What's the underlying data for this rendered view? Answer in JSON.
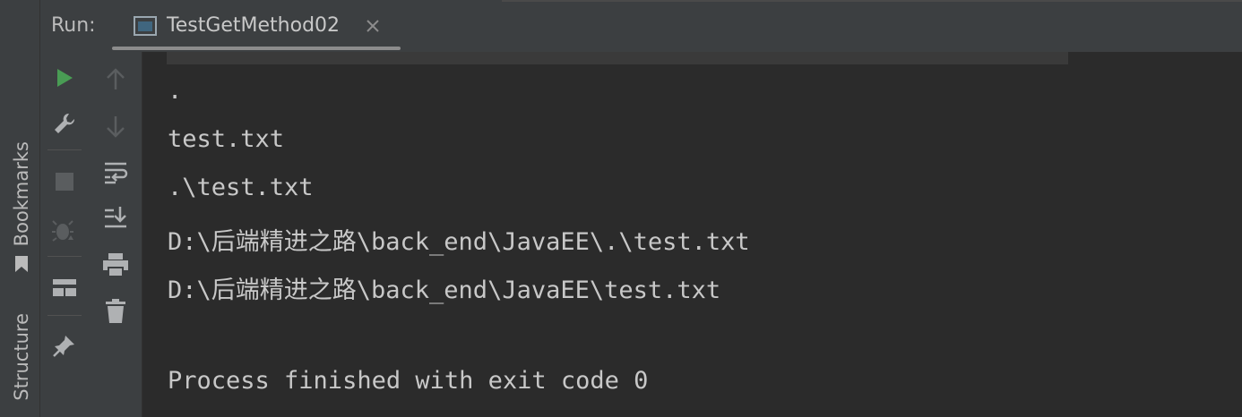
{
  "side_tabs": {
    "bookmarks": "Bookmarks",
    "structure": "Structure"
  },
  "header": {
    "run_label": "Run:",
    "tab_title": "TestGetMethod02"
  },
  "toolbar_left": [
    {
      "icon": "run-icon",
      "color": "#499c54"
    },
    {
      "icon": "wrench-icon"
    },
    {
      "icon": "stop-icon"
    },
    {
      "icon": "debug-icon"
    },
    {
      "icon": "layout-icon"
    },
    {
      "icon": "pin-icon"
    }
  ],
  "toolbar_right": [
    {
      "icon": "arrow-up-icon"
    },
    {
      "icon": "arrow-down-icon"
    },
    {
      "icon": "soft-wrap-icon"
    },
    {
      "icon": "scroll-to-end-icon"
    },
    {
      "icon": "print-icon"
    },
    {
      "icon": "trash-icon"
    }
  ],
  "console": {
    "lines": [
      ".",
      "test.txt",
      ".\\test.txt",
      "D:\\后端精进之路\\back_end\\JavaEE\\.\\test.txt",
      "D:\\后端精进之路\\back_end\\JavaEE\\test.txt",
      "",
      "Process finished with exit code 0"
    ]
  },
  "colors": {
    "background": "#2b2b2b",
    "panel": "#3c3f41",
    "text": "#c8c8c8",
    "run_green": "#499c54"
  }
}
